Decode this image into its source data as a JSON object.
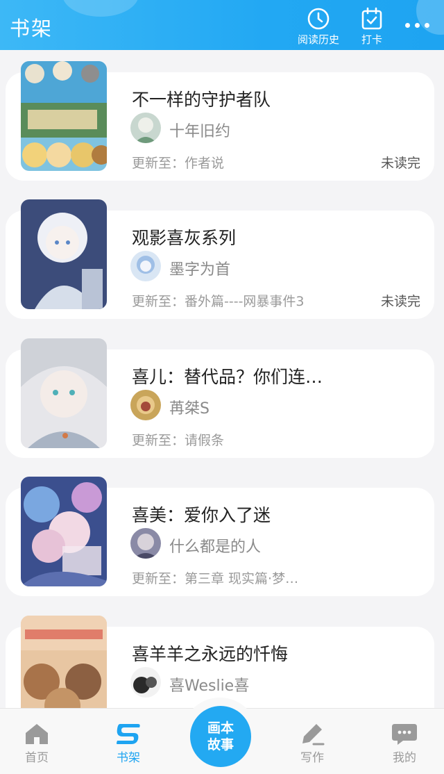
{
  "header": {
    "title": "书架",
    "history_label": "阅读历史",
    "checkin_label": "打卡"
  },
  "books": [
    {
      "title": "不一样的守护者队",
      "author": "十年旧约",
      "update": "更新至：作者说",
      "status": "未读完"
    },
    {
      "title": "观影喜灰系列",
      "author": "墨字为首",
      "update": "更新至：番外篇----网暴事件3",
      "status": "未读完"
    },
    {
      "title": "喜儿：替代品？你们连…",
      "author": "苒桀S",
      "update": "更新至：请假条",
      "status": ""
    },
    {
      "title": "喜美：爱你入了迷",
      "author": "什么都是的人",
      "update": "更新至：第三章 现实篇·梦…",
      "status": ""
    },
    {
      "title": "喜羊羊之永远的忏悔",
      "author": "喜Weslie喜",
      "update": "",
      "status": ""
    }
  ],
  "nav": {
    "home": "首页",
    "shelf": "书架",
    "center_line1": "画本",
    "center_line2": "故事",
    "write": "写作",
    "mine": "我的"
  },
  "colors": {
    "accent": "#1ea4f1",
    "header_bg": "#22a8f3",
    "page_bg": "#f4f4f6"
  }
}
